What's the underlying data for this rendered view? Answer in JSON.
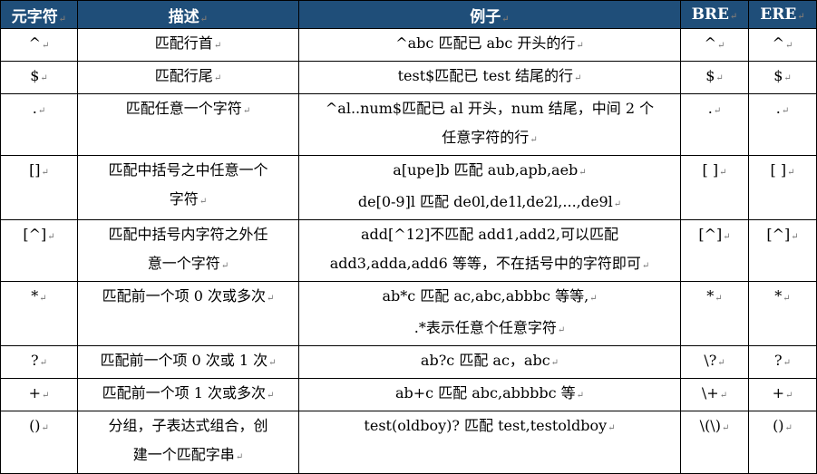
{
  "headers": [
    "元字符",
    "描述",
    "例子",
    "BRE",
    "ERE"
  ],
  "rows": [
    {
      "meta": "^",
      "desc": [
        "匹配行首"
      ],
      "example": [
        "^abc 匹配已 abc 开头的行"
      ],
      "bre": "^",
      "ere": "^"
    },
    {
      "meta": "$",
      "desc": [
        "匹配行尾"
      ],
      "example": [
        "test$匹配已 test 结尾的行"
      ],
      "bre": "$",
      "ere": "$"
    },
    {
      "meta": ".",
      "desc": [
        "匹配任意一个字符"
      ],
      "example": [
        "^al..num$匹配已 al 开头，num 结尾，中间 2 个",
        "任意字符的行"
      ],
      "bre": ".",
      "ere": "."
    },
    {
      "meta": "[]",
      "desc": [
        "匹配中括号之中任意一个",
        "字符"
      ],
      "example": [
        "a[upe]b 匹配 aub,apb,aeb",
        "de[0-9]l  匹配 de0l,de1l,de2l,...,de9l"
      ],
      "bre": "[ ]",
      "ere": "[ ]"
    },
    {
      "meta": "[^]",
      "desc": [
        "匹配中括号内字符之外任",
        "意一个字符"
      ],
      "example": [
        "add[^12]不匹配 add1,add2,可以匹配",
        "add3,adda,add6 等等，不在括号中的字符即可"
      ],
      "bre": "[^]",
      "ere": "[^]"
    },
    {
      "meta": "*",
      "desc": [
        "匹配前一个项 0 次或多次"
      ],
      "example": [
        "ab*c 匹配 ac,abc,abbbc 等等,",
        ".*表示任意个任意字符"
      ],
      "bre": "*",
      "ere": "*"
    },
    {
      "meta": "?",
      "desc": [
        "匹配前一个项 0 次或 1 次"
      ],
      "example": [
        "ab?c  匹配 ac，abc"
      ],
      "bre": "\\?",
      "ere": "?"
    },
    {
      "meta": "+",
      "desc": [
        "匹配前一个项 1 次或多次"
      ],
      "example": [
        "ab+c  匹配 abc,abbbbc 等"
      ],
      "bre": "\\+",
      "ere": "+"
    },
    {
      "meta": "()",
      "desc": [
        "分组，子表达式组合，创",
        "建一个匹配字串"
      ],
      "example": [
        "test(oldboy)?  匹配 test,testoldboy"
      ],
      "bre": "\\(\\)",
      "ere": "()"
    }
  ],
  "paragraph_mark": "↵",
  "colors": {
    "header_bg": "#1f4e79",
    "header_text": "#ffffff",
    "border": "#000000"
  }
}
